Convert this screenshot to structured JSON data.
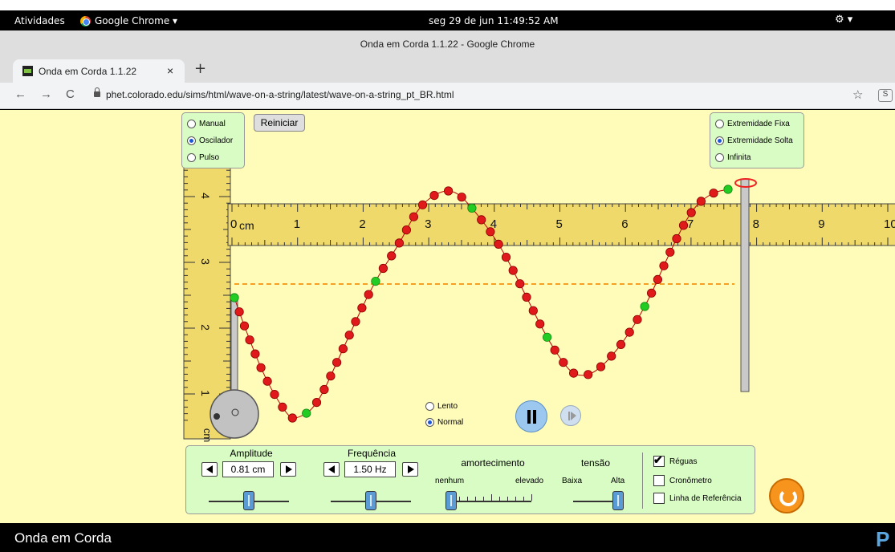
{
  "os_bar": {
    "activities": "Atividades",
    "app_name": "Google Chrome ▾",
    "clock": "seg 29 de jun  11:49:52 AM",
    "right_icons": "⚙ ▾"
  },
  "browser": {
    "window_title": "Onda em Corda 1.1.22 - Google Chrome",
    "tab_title": "Onda em Corda 1.1.22",
    "tab_close": "×",
    "new_tab": "+",
    "back": "←",
    "forward": "→",
    "reload": "C",
    "url": "phet.colorado.edu/sims/html/wave-on-a-string/latest/wave-on-a-string_pt_BR.html",
    "star": "☆",
    "extension": "S"
  },
  "mode_panel": {
    "options": [
      "Manual",
      "Oscilador",
      "Pulso"
    ],
    "selected": "Oscilador"
  },
  "reset_button": "Reiniciar",
  "end_panel": {
    "options": [
      "Extremidade Fixa",
      "Extremidade Solta",
      "Infinita"
    ],
    "selected": "Extremidade Solta"
  },
  "h_ruler": {
    "unit": "cm",
    "labels": [
      "0",
      "1",
      "2",
      "3",
      "4",
      "5",
      "6",
      "7",
      "8",
      "9",
      "10"
    ]
  },
  "v_ruler": {
    "labels": [
      "4",
      "3",
      "2",
      "1"
    ],
    "unit": "cm"
  },
  "speed_panel": {
    "options": [
      "Lento",
      "Normal"
    ],
    "selected": "Normal"
  },
  "controls": {
    "amplitude": {
      "label": "Amplitude",
      "value": "0.81 cm",
      "level": 0.5
    },
    "frequency": {
      "label": "Frequência",
      "value": "1.50 Hz",
      "level": 0.5
    },
    "damping": {
      "label": "amortecimento",
      "min_label": "nenhum",
      "max_label": "elevado",
      "level": 0.0
    },
    "tension": {
      "label": "tensão",
      "min_label": "Baixa",
      "max_label": "Alta",
      "level": 1.0
    }
  },
  "checkboxes": [
    {
      "label": "Réguas",
      "checked": true
    },
    {
      "label": "Cronômetro",
      "checked": false
    },
    {
      "label": "Linha de Referência",
      "checked": false
    }
  ],
  "footer": {
    "sim_title": "Onda em Corda",
    "logo": "P"
  },
  "colors": {
    "sim_bg": "#fffbb9",
    "panel_bg": "#d9fcc5",
    "ruler": "#efd96b",
    "bead_red": "#e01a1a",
    "bead_green": "#22cc22",
    "reference_line": "#f4a024"
  }
}
